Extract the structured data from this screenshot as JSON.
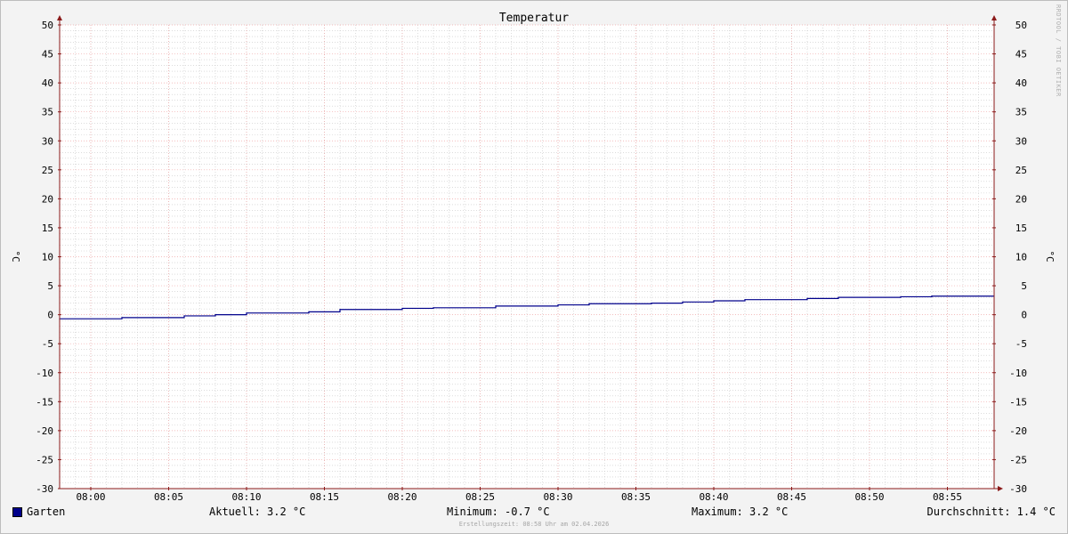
{
  "chart_data": {
    "type": "line",
    "title": "Temperatur",
    "ylabel": "°C",
    "ylabel_right": "°C",
    "ylim": [
      -30,
      50
    ],
    "yticks": [
      50,
      45,
      40,
      35,
      30,
      25,
      20,
      15,
      10,
      5,
      0,
      -5,
      -10,
      -15,
      -20,
      -25,
      -30
    ],
    "ytick_labels": [
      "50",
      "45",
      "40",
      "35",
      "30",
      "25",
      "20",
      "15",
      "10",
      "5",
      "0",
      "-5",
      "-10",
      "-15",
      "-20",
      "-25",
      "-30"
    ],
    "xlim": [
      "07:58",
      "08:58"
    ],
    "xticks": [
      "08:00",
      "08:05",
      "08:10",
      "08:15",
      "08:20",
      "08:25",
      "08:30",
      "08:35",
      "08:40",
      "08:45",
      "08:50",
      "08:55"
    ],
    "grid": true,
    "legend_position": "bottom-left",
    "series": [
      {
        "name": "Garten",
        "color": "#00008b",
        "step": true,
        "x": [
          "07:58",
          "08:02",
          "08:06",
          "08:08",
          "08:10",
          "08:14",
          "08:16",
          "08:20",
          "08:22",
          "08:26",
          "08:30",
          "08:32",
          "08:36",
          "08:38",
          "08:40",
          "08:42",
          "08:46",
          "08:48",
          "08:52",
          "08:54"
        ],
        "values": [
          -0.7,
          -0.5,
          -0.2,
          0.0,
          0.3,
          0.5,
          0.9,
          1.1,
          1.2,
          1.5,
          1.7,
          1.9,
          2.0,
          2.2,
          2.4,
          2.6,
          2.8,
          3.0,
          3.1,
          3.2
        ]
      }
    ],
    "x_end": "08:58"
  },
  "colors": {
    "background": "#f3f3f3",
    "plot_background": "#ffffff",
    "major_grid": "#f0a8a8",
    "minor_grid": "#c8c8c8",
    "axis": "#8b1a1a",
    "arrow": "#8b1a1a"
  },
  "watermark": "RRDTOOL / TOBI OETIKER",
  "legend": {
    "series_name": "Garten",
    "current": "Aktuell: 3.2 °C",
    "minimum": "Minimum: -0.7 °C",
    "maximum": "Maximum: 3.2 °C",
    "average": "Durchschnitt: 1.4 °C"
  },
  "footer": "Erstellungszeit: 08:58 Uhr am 02.04.2026"
}
